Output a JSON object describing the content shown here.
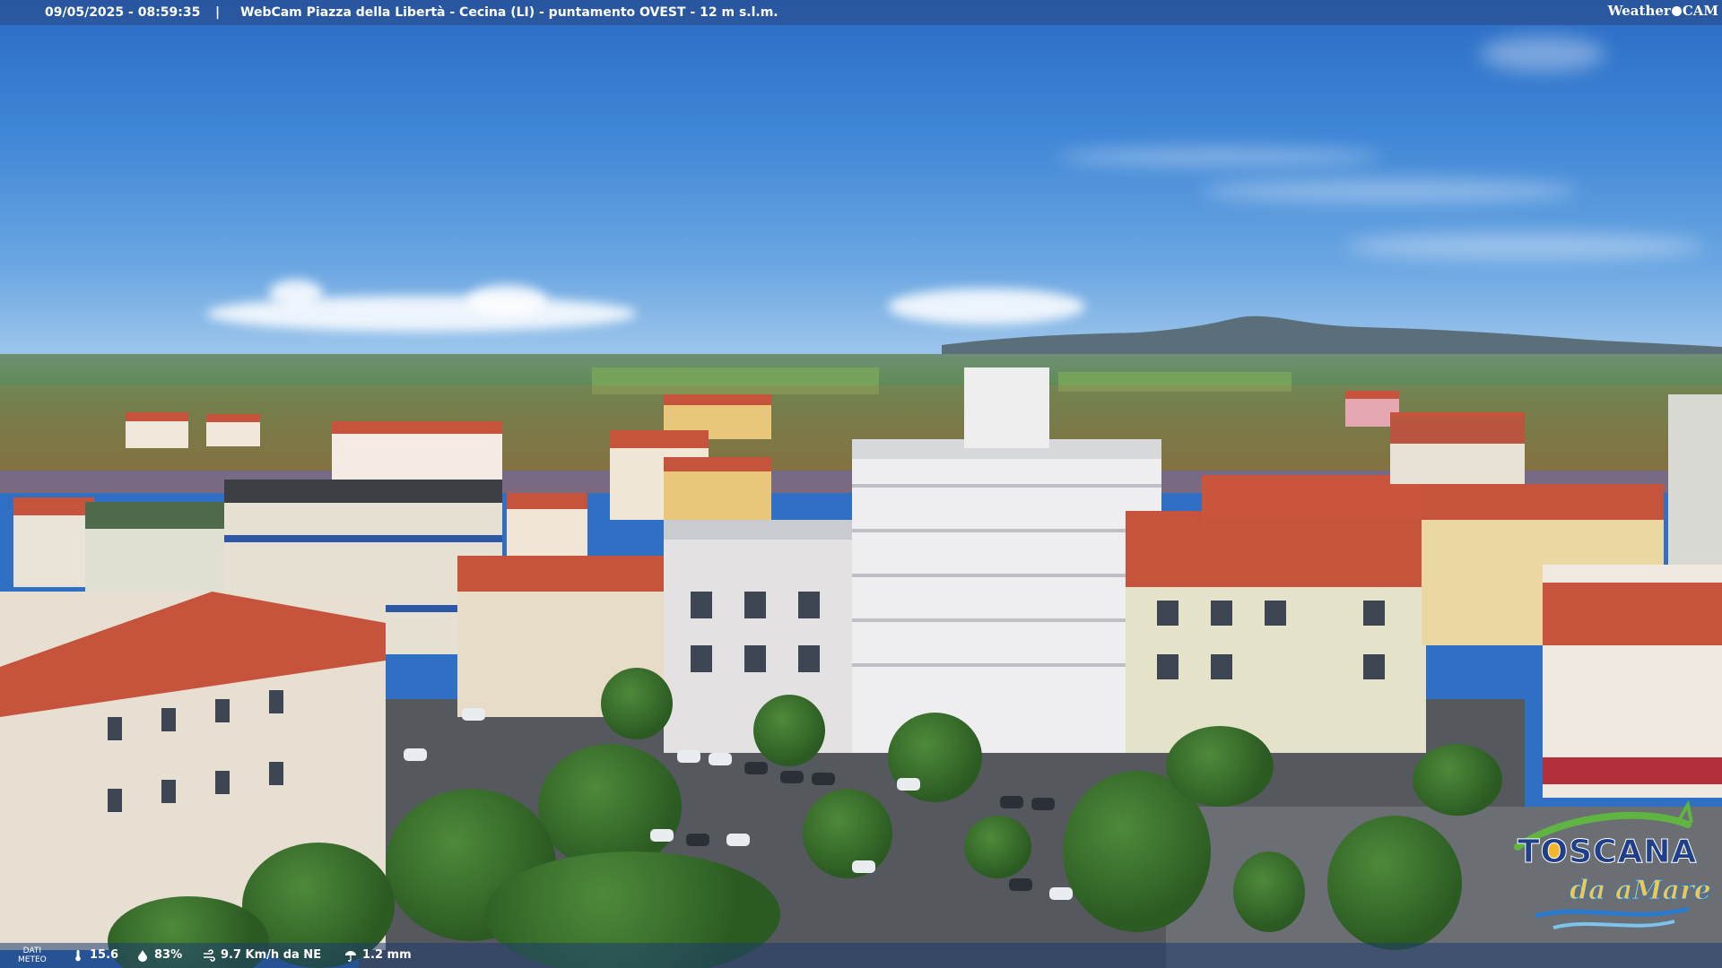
{
  "header": {
    "datetime": "09/05/2025 - 08:59:35",
    "separator": "|",
    "caption": "WebCam Piazza della Libertà - Cecina (LI) - puntamento OVEST - 12 m s.l.m.",
    "brand_left": "Weather",
    "brand_right": "CAM"
  },
  "weather_bar": {
    "label_line1": "DATI",
    "label_line2": "METEO",
    "temperature": "15.6",
    "humidity": "83%",
    "wind": "9.7 Km/h da NE",
    "rain": "1.2 mm",
    "icons": [
      "thermometer-icon",
      "humidity-drop-icon",
      "wind-icon",
      "rain-umbrella-icon"
    ]
  },
  "logo": {
    "title": "TOSCANA",
    "subtitle": "da aMare"
  },
  "colors": {
    "sky_top": "#2a6bc4",
    "roof": "#c6533b",
    "overlay_text": "#ffffff"
  }
}
